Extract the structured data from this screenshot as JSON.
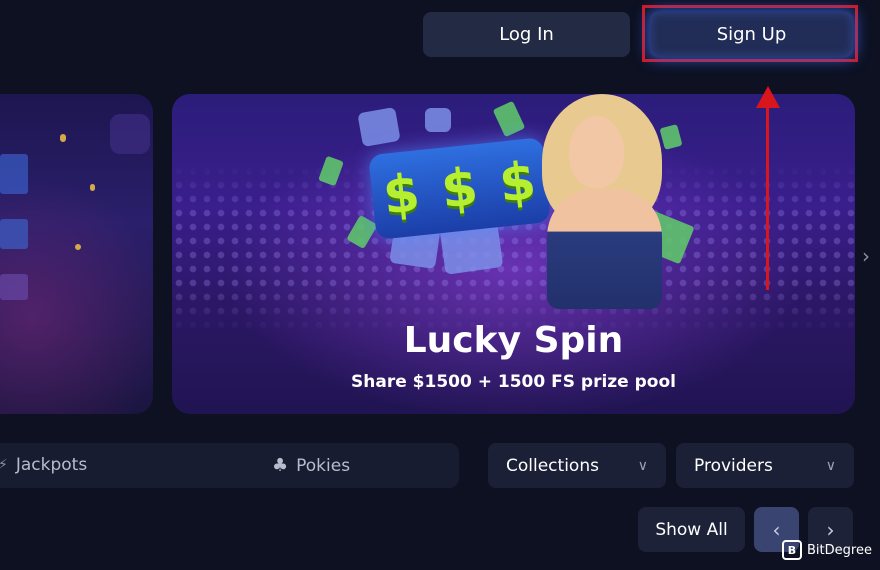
{
  "header": {
    "login_label": "Log In",
    "signup_label": "Sign Up"
  },
  "annotation": {
    "color": "#d8161c"
  },
  "banner": {
    "title": "Lucky Spin",
    "subtitle": "Share $1500 + 1500 FS prize pool",
    "slot_symbols": [
      "$",
      "$",
      "$"
    ]
  },
  "carousel": {
    "next_icon": "chevron-right-icon"
  },
  "categories": [
    {
      "label": "Jackpots",
      "icon": "jackpot-icon"
    },
    {
      "label": "Pokies",
      "icon": "cherry-icon"
    }
  ],
  "filters": {
    "collections_label": "Collections",
    "providers_label": "Providers"
  },
  "games_nav": {
    "show_all_label": "Show All",
    "prev_icon": "chevron-left-icon",
    "next_icon": "chevron-right-icon"
  },
  "watermark": {
    "logo_text": "B",
    "text": "BitDegree"
  },
  "colors": {
    "background": "#0d1122",
    "accent": "#212d57",
    "highlight": "#d8161c"
  }
}
